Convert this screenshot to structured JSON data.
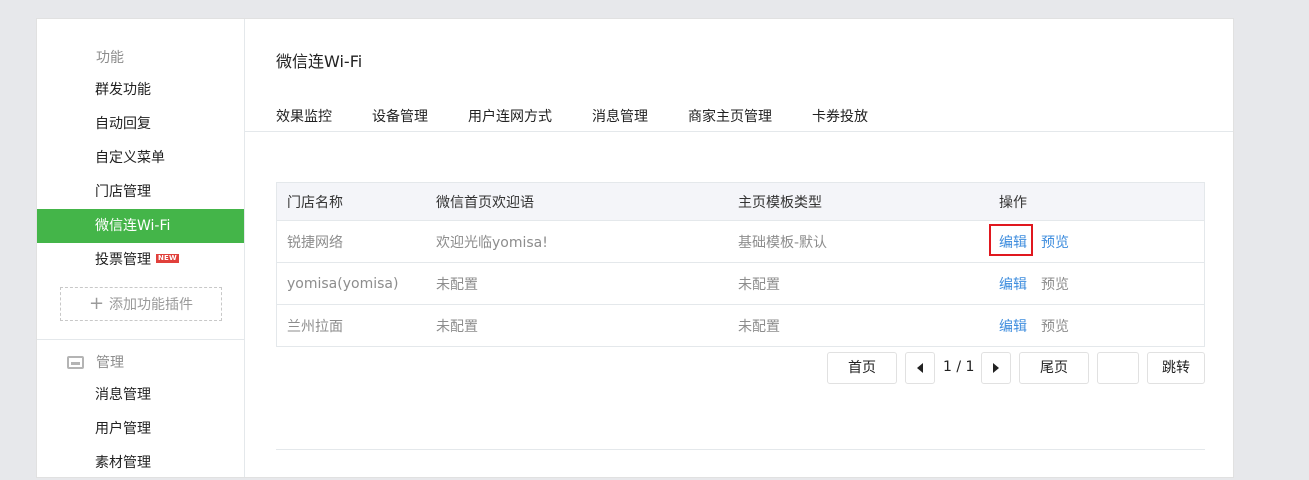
{
  "sidebar": {
    "sections": [
      {
        "title": "功能",
        "icon": "grid-icon"
      },
      {
        "title": "管理",
        "icon": "inbox-icon"
      }
    ],
    "function_items": [
      {
        "label": "群发功能"
      },
      {
        "label": "自动回复"
      },
      {
        "label": "自定义菜单"
      },
      {
        "label": "门店管理"
      },
      {
        "label": "微信连Wi-Fi",
        "active": true
      },
      {
        "label": "投票管理",
        "badge": "NEW"
      }
    ],
    "add_plugin_label": "添加功能插件",
    "manage_items": [
      {
        "label": "消息管理"
      },
      {
        "label": "用户管理"
      },
      {
        "label": "素材管理"
      }
    ]
  },
  "main": {
    "title": "微信连Wi-Fi",
    "tabs": [
      {
        "label": "效果监控"
      },
      {
        "label": "设备管理"
      },
      {
        "label": "用户连网方式"
      },
      {
        "label": "消息管理"
      },
      {
        "label": "商家主页管理"
      },
      {
        "label": "卡券投放"
      }
    ],
    "table": {
      "headers": [
        "门店名称",
        "微信首页欢迎语",
        "主页模板类型",
        "操作"
      ],
      "rows": [
        {
          "name": "锐捷网络",
          "welcome": "欢迎光临yomisa!",
          "template": "基础模板-默认",
          "edit": "编辑",
          "preview": "预览"
        },
        {
          "name": "yomisa(yomisa)",
          "welcome": "未配置",
          "template": "未配置",
          "edit": "编辑",
          "preview": "预览"
        },
        {
          "name": "兰州拉面",
          "welcome": "未配置",
          "template": "未配置",
          "edit": "编辑",
          "preview": "预览"
        }
      ]
    },
    "pagination": {
      "first": "首页",
      "page": "1 / 1",
      "last": "尾页",
      "jump_value": "",
      "jump": "跳转"
    }
  },
  "colors": {
    "accent_green": "#44b549",
    "link_blue": "#3e8dde",
    "highlight_red": "#e0181f",
    "badge_red": "#e1403b"
  }
}
